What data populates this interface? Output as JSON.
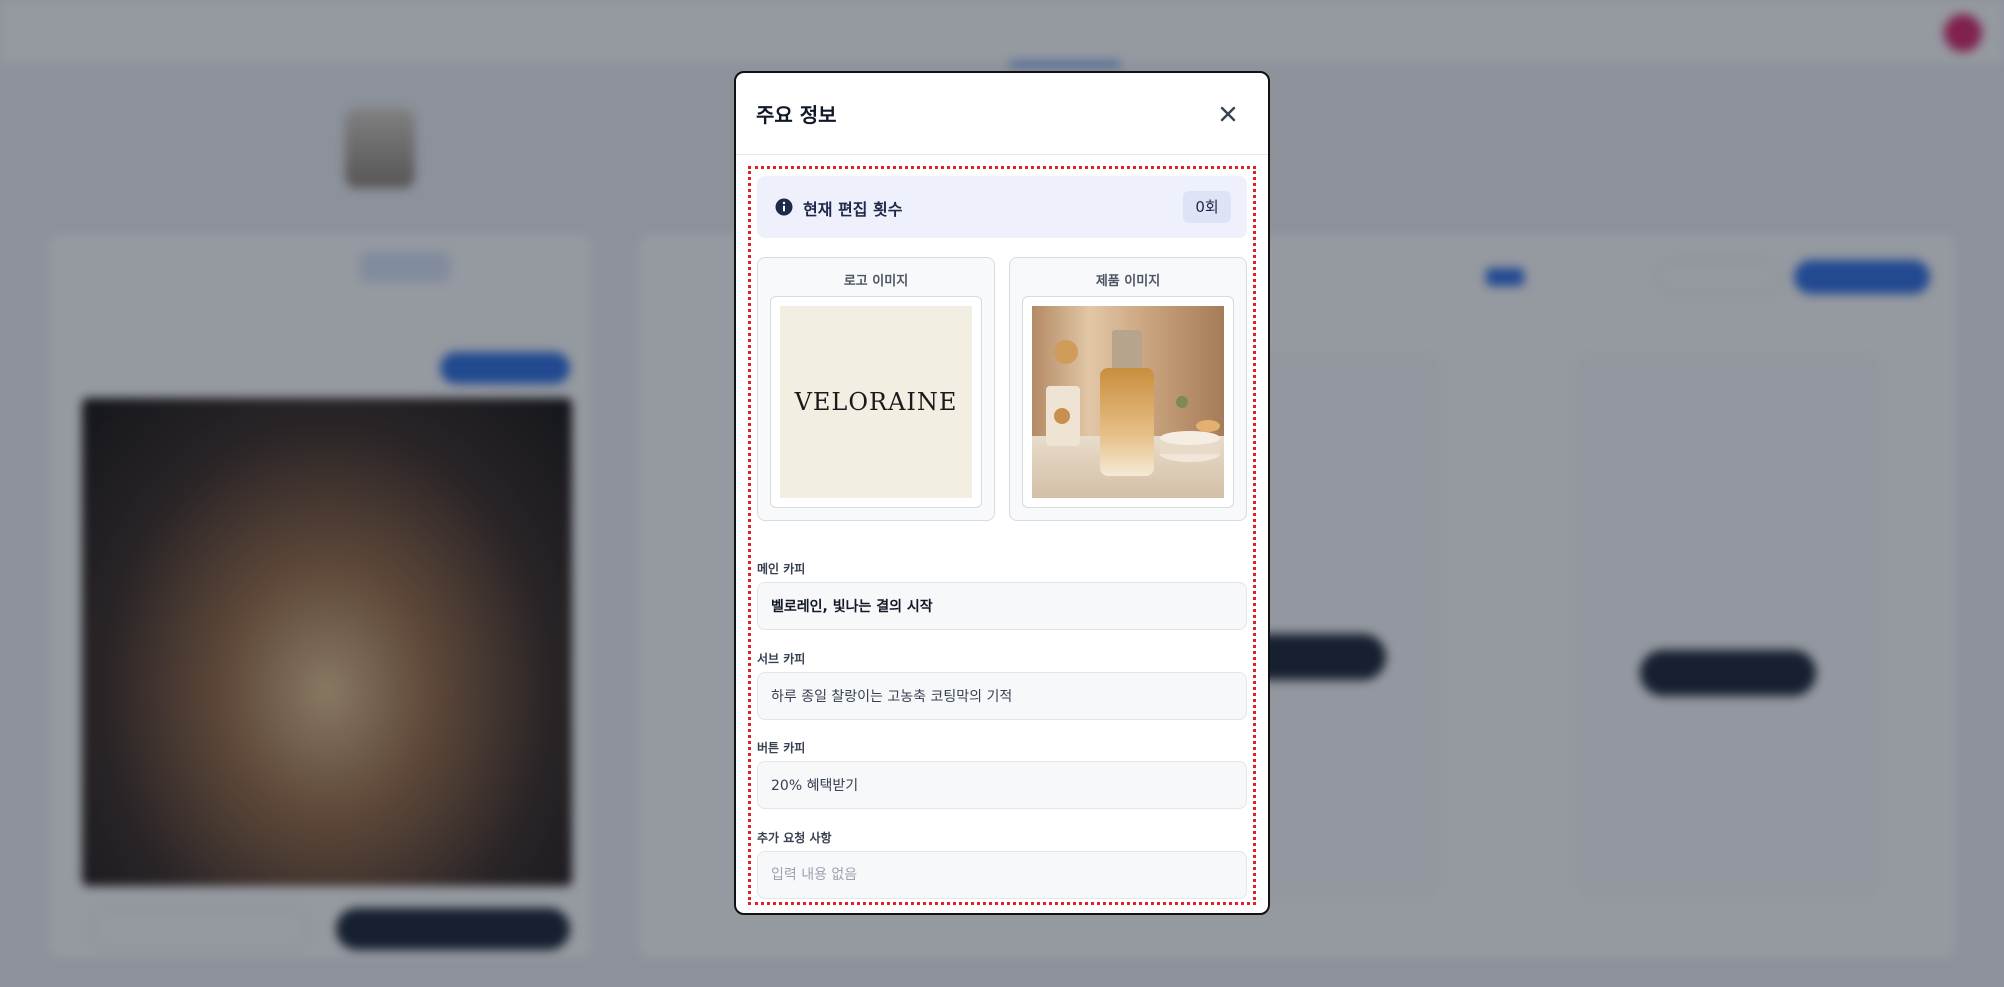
{
  "modal": {
    "title": "주요 정보",
    "edit_count_label": "현재 편집 횟수",
    "edit_count_value": "0회",
    "logo_card_label": "로고 이미지",
    "logo_text": "VELORAINE",
    "product_card_label": "제품 이미지",
    "fields": {
      "main_copy": {
        "label": "메인 카피",
        "value": "벨로레인, 빛나는 결의 시작"
      },
      "sub_copy": {
        "label": "서브 카피",
        "value": "하루 종일 찰랑이는 고농축 코팅막의 기적"
      },
      "button_copy": {
        "label": "버튼 카피",
        "value": "20% 혜택받기"
      },
      "extra_request": {
        "label": "추가 요청 사항",
        "placeholder": "입력 내용 없음"
      }
    }
  },
  "colors": {
    "highlight_border": "#e0202a",
    "info_bg": "#eef0fc",
    "accent_blue": "#2f6fe4"
  },
  "icons": {
    "close": "close-icon",
    "info": "info-circle-icon"
  }
}
